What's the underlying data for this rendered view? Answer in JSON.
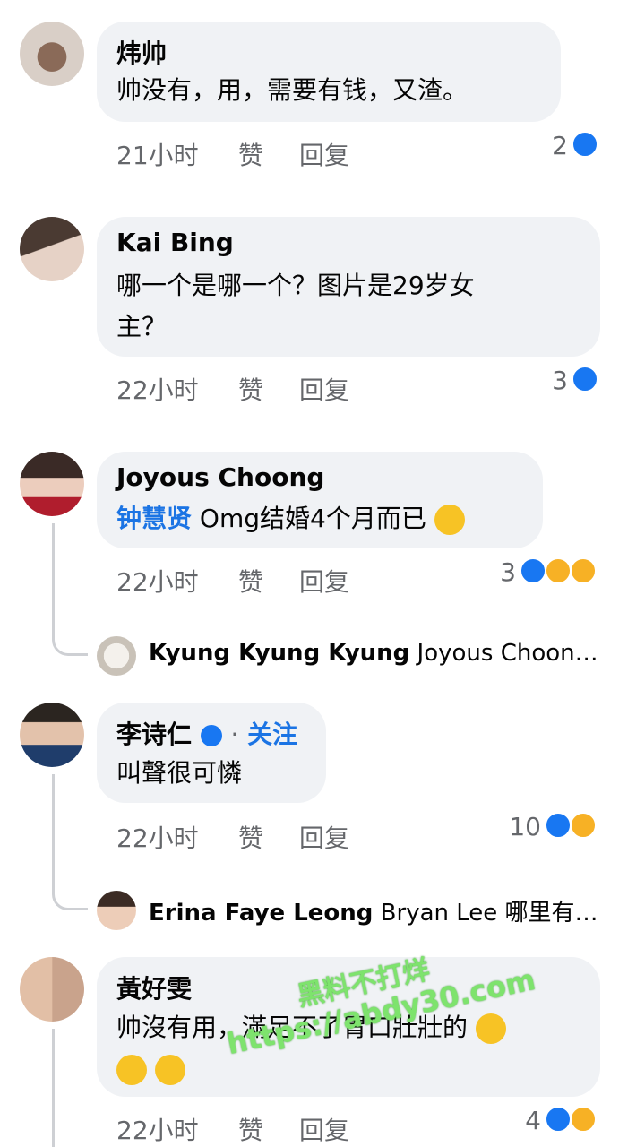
{
  "comments": [
    {
      "author": "炜帅",
      "text": "帅没有，用，需要有钱，又渣。",
      "time": "21小时",
      "like": "赞",
      "reply": "回复",
      "count": "2"
    },
    {
      "author": "Kai Bing",
      "text_line1": "哪一个是哪一个？图片是29岁女",
      "text_line2": "主？",
      "time": "22小时",
      "like": "赞",
      "reply": "回复",
      "count": "3"
    },
    {
      "author": "Joyous Choong",
      "mention": "钟慧贤",
      "text": " Omg结婚4个月而已",
      "time": "22小时",
      "like": "赞",
      "reply": "回复",
      "count": "3",
      "reply_preview": {
        "name": "Kyung Kyung Kyung",
        "snippet": " Joyous Choon…"
      }
    },
    {
      "author": "李诗仁",
      "follow": "关注",
      "dot": "·",
      "text": "叫聲很可憐",
      "time": "22小时",
      "like": "赞",
      "reply": "回复",
      "count": "10",
      "reply_preview": {
        "name": "Erina Faye Leong",
        "snippet": " Bryan Lee 哪里有…"
      }
    },
    {
      "author": "黃好雯",
      "text_line1": "帅沒有用，滿足不了胃口壯壯的",
      "time": "22小时",
      "like": "赞",
      "reply": "回复",
      "count": "4"
    }
  ],
  "watermark": {
    "line1": "黑料不打烊",
    "line2": "https://abdy30.com"
  },
  "colors": {
    "like": "#1877f2",
    "mention": "#1b74e4",
    "bubble": "#f0f2f5",
    "meta": "#65676b"
  },
  "icons": [
    "like-reaction-icon",
    "wow-reaction-icon",
    "sad-reaction-icon",
    "haha-reaction-icon",
    "laugh-tears-emoji",
    "verified-badge-icon"
  ]
}
